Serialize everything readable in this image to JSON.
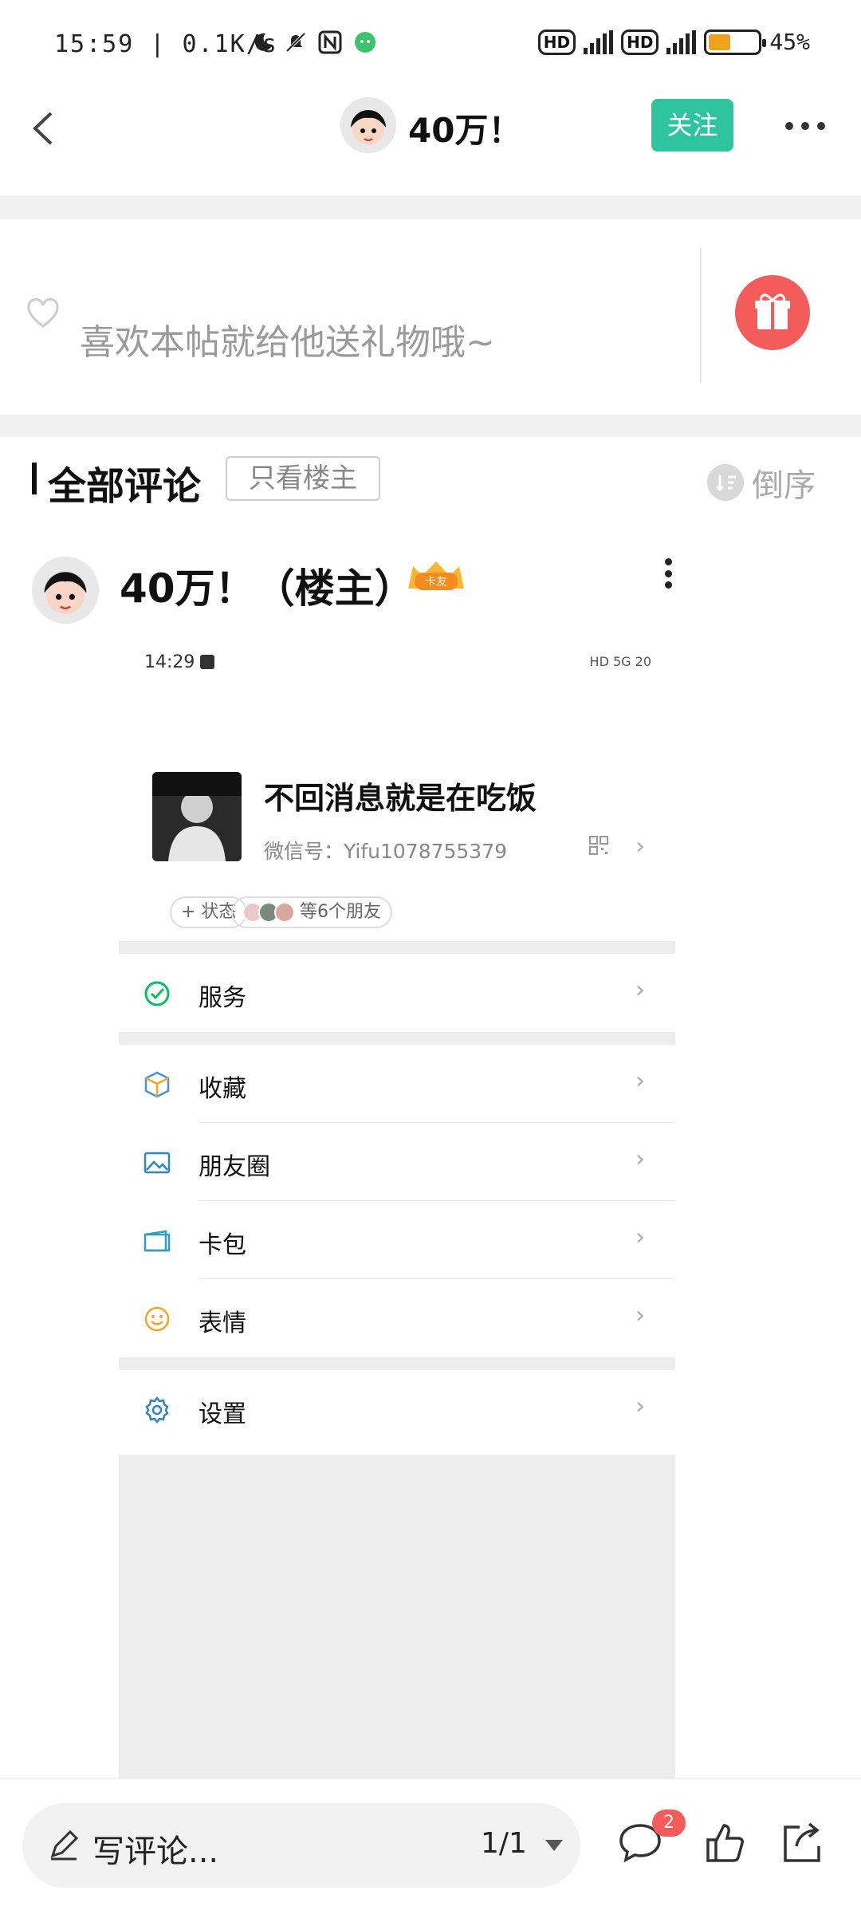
{
  "status_bar": {
    "time": "15:59",
    "net_speed": "0.1K/s",
    "hd1": "HD",
    "hd2": "HD",
    "battery": "45%",
    "battery_level": 0.45
  },
  "nav": {
    "title": "40万！",
    "follow_label": "关注"
  },
  "gift": {
    "text": "喜欢本帖就给他送礼物哦~"
  },
  "comments": {
    "title": "全部评论",
    "only_op_label": "只看楼主",
    "sort_label": "倒序"
  },
  "post": {
    "author": "40万！（楼主）",
    "badge_label": "卡友"
  },
  "embedded": {
    "time": "14:29",
    "status_icons": "HD 5G 20",
    "profile": {
      "name": "不回消息就是在吃饭",
      "wechat_id": "微信号：Yifu1078755379",
      "status_pill": "+ 状态",
      "friends_pill": "等6个朋友"
    },
    "menu": [
      {
        "label": "服务",
        "icon": "wechat-pay-icon"
      },
      {
        "label": "收藏",
        "icon": "cube-icon"
      },
      {
        "label": "朋友圈",
        "icon": "photo-icon"
      },
      {
        "label": "卡包",
        "icon": "card-icon"
      },
      {
        "label": "表情",
        "icon": "smiley-icon"
      },
      {
        "label": "设置",
        "icon": "gear-icon"
      }
    ]
  },
  "bottom": {
    "placeholder": "写评论...",
    "page_indicator": "1/1",
    "comment_count": "2"
  },
  "colors": {
    "accent": "#2ec4a0",
    "gift_red": "#f45b5b",
    "battery": "#f0a21c"
  }
}
